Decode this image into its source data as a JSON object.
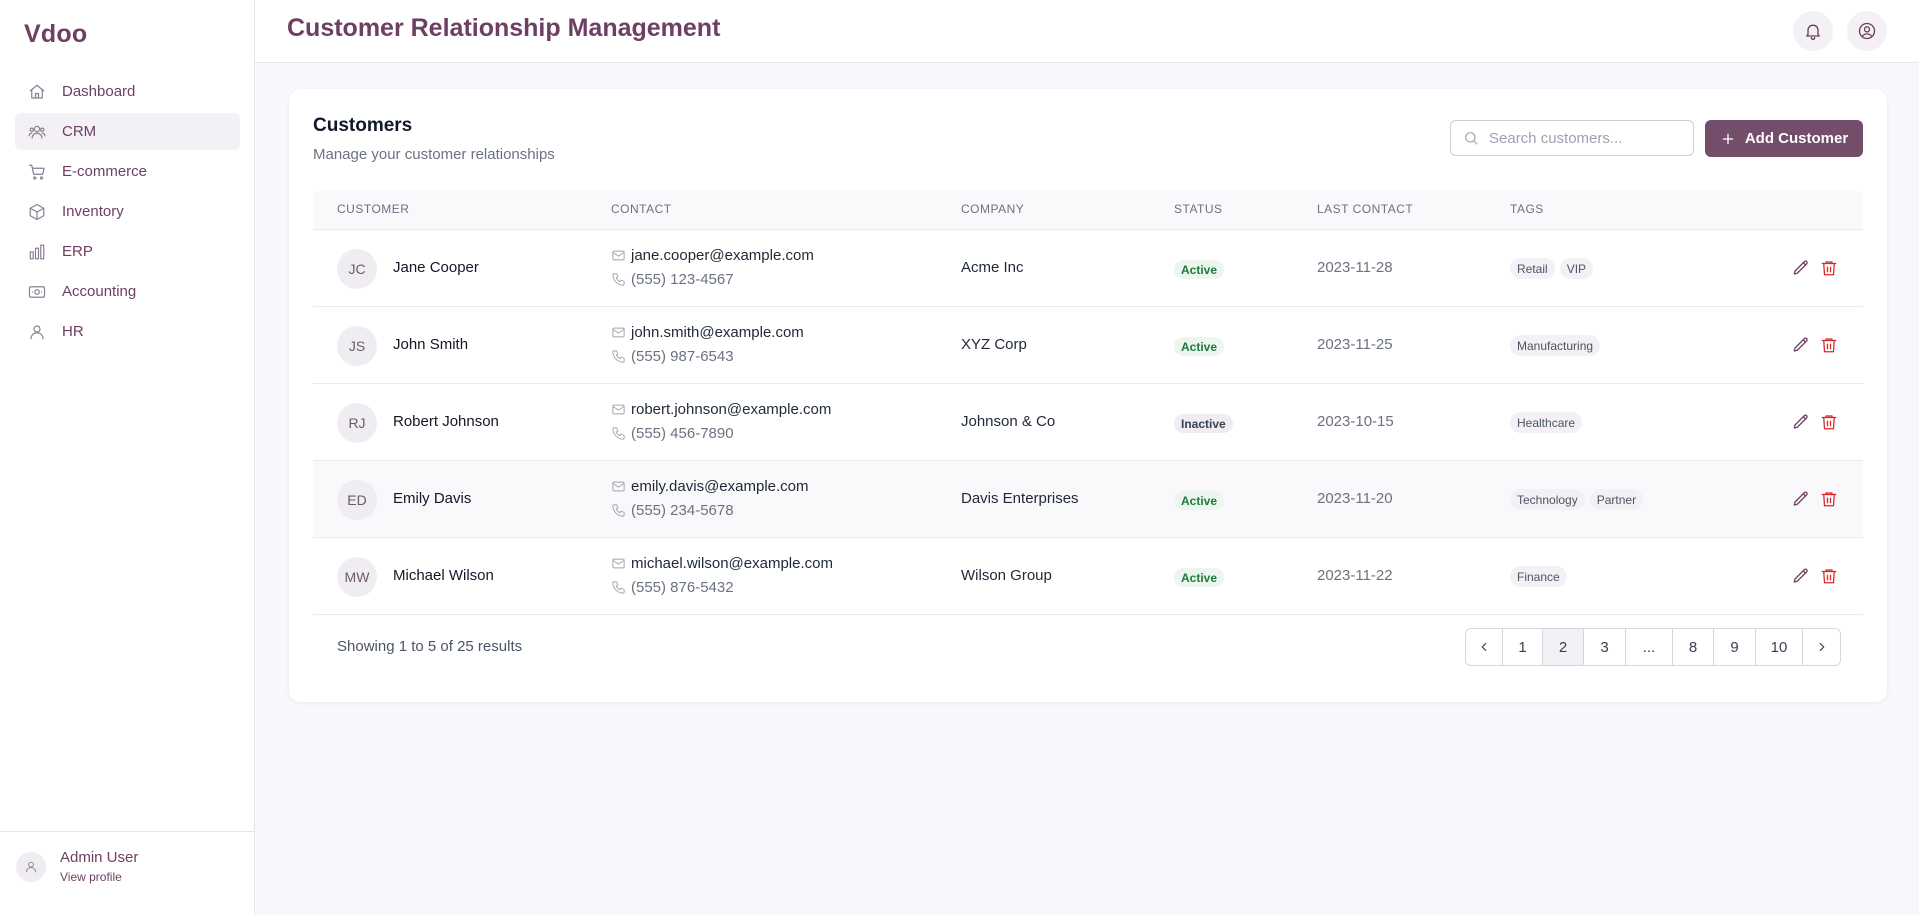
{
  "app": {
    "brand": "Vdoo",
    "title": "Customer Relationship Management"
  },
  "sidebar": {
    "items": [
      {
        "label": "Dashboard",
        "icon": "home-icon",
        "active": false
      },
      {
        "label": "CRM",
        "icon": "users-icon",
        "active": true
      },
      {
        "label": "E-commerce",
        "icon": "cart-icon",
        "active": false
      },
      {
        "label": "Inventory",
        "icon": "box-icon",
        "active": false
      },
      {
        "label": "ERP",
        "icon": "bar-chart-icon",
        "active": false
      },
      {
        "label": "Accounting",
        "icon": "banknote-icon",
        "active": false
      },
      {
        "label": "HR",
        "icon": "user-icon",
        "active": false
      }
    ],
    "user": {
      "name": "Admin User",
      "link": "View profile"
    }
  },
  "header": {
    "icons": [
      "bell-icon",
      "user-circle-icon"
    ]
  },
  "customers": {
    "title": "Customers",
    "subtitle": "Manage your customer relationships",
    "search_placeholder": "Search customers...",
    "add_label": "Add Customer",
    "columns": [
      "CUSTOMER",
      "CONTACT",
      "COMPANY",
      "STATUS",
      "LAST CONTACT",
      "TAGS"
    ],
    "rows": [
      {
        "initials": "JC",
        "name": "Jane Cooper",
        "email": "jane.cooper@example.com",
        "phone": "(555) 123-4567",
        "company": "Acme Inc",
        "status": "Active",
        "last_contact": "2023-11-28",
        "tags": [
          "Retail",
          "VIP"
        ]
      },
      {
        "initials": "JS",
        "name": "John Smith",
        "email": "john.smith@example.com",
        "phone": "(555) 987-6543",
        "company": "XYZ Corp",
        "status": "Active",
        "last_contact": "2023-11-25",
        "tags": [
          "Manufacturing"
        ]
      },
      {
        "initials": "RJ",
        "name": "Robert Johnson",
        "email": "robert.johnson@example.com",
        "phone": "(555) 456-7890",
        "company": "Johnson & Co",
        "status": "Inactive",
        "last_contact": "2023-10-15",
        "tags": [
          "Healthcare"
        ]
      },
      {
        "initials": "ED",
        "name": "Emily Davis",
        "email": "emily.davis@example.com",
        "phone": "(555) 234-5678",
        "company": "Davis Enterprises",
        "status": "Active",
        "last_contact": "2023-11-20",
        "tags": [
          "Technology",
          "Partner"
        ]
      },
      {
        "initials": "MW",
        "name": "Michael Wilson",
        "email": "michael.wilson@example.com",
        "phone": "(555) 876-5432",
        "company": "Wilson Group",
        "status": "Active",
        "last_contact": "2023-11-22",
        "tags": [
          "Finance"
        ]
      }
    ],
    "results_text": "Showing 1 to 5 of 25 results",
    "pagination": {
      "pages": [
        "1",
        "2",
        "3",
        "...",
        "8",
        "9",
        "10"
      ],
      "current": "2"
    }
  },
  "colors": {
    "brand": "#6d3f62",
    "accent_button": "#744d6b",
    "active_badge_bg": "#ecf6ef",
    "active_badge_text": "#1f7a3a",
    "delete": "#dc2626"
  }
}
